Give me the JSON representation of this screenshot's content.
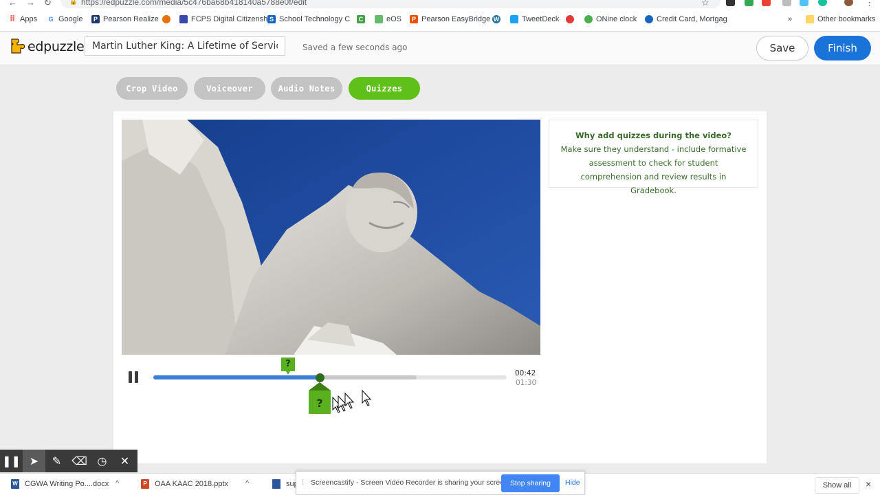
{
  "browser": {
    "url": "https://edpuzzle.com/media/5c476ba68b418140a5788e0f/edit",
    "bookmarks": [
      {
        "label": "Apps",
        "color": "#ea4335"
      },
      {
        "label": "Google",
        "color": "#4285f4"
      },
      {
        "label": "Pearson Realize",
        "color": "#1e3a6e"
      },
      {
        "label": "",
        "color": "#e8710a"
      },
      {
        "label": "FCPS Digital Citizensh",
        "color": "#3949ab"
      },
      {
        "label": "School Technology C",
        "color": "#1565c0"
      },
      {
        "label": "",
        "color": "#43a047"
      },
      {
        "label": "eOS",
        "color": "#66bb6a"
      },
      {
        "label": "Pearson EasyBridge",
        "color": "#e65100"
      },
      {
        "label": "",
        "color": "#21759b"
      },
      {
        "label": "TweetDeck",
        "color": "#1da1f2"
      },
      {
        "label": "",
        "color": "#e53935"
      },
      {
        "label": "ONine clock",
        "color": "#4caf50"
      },
      {
        "label": "Credit Card, Mortgag",
        "color": "#1565c0"
      }
    ],
    "bookmarks_more": "»",
    "other_bookmarks": "Other bookmarks"
  },
  "header": {
    "logo": "edpuzzle",
    "video_title": "Martin Luther King: A Lifetime of Service",
    "saved_status": "Saved a few seconds ago",
    "save_label": "Save",
    "finish_label": "Finish"
  },
  "tabs": [
    {
      "label": "Crop Video",
      "active": false
    },
    {
      "label": "Voiceover",
      "active": false
    },
    {
      "label": "Audio Notes",
      "active": false
    },
    {
      "label": "Quizzes",
      "active": true
    }
  ],
  "info": {
    "title": "Why add quizzes during the video?",
    "body": "Make sure they understand - include formative assessment to check for student comprehension and review results in Gradebook."
  },
  "player": {
    "current_time": "00:42",
    "total_time": "01:30",
    "progress_fraction": 0.47,
    "buffered_fraction": 0.745,
    "quiz_marker_label": "?",
    "add_quiz_label": "?"
  },
  "downloads": [
    {
      "label": "CGWA Writing Po....docx",
      "color": "#2b579a",
      "type": "W"
    },
    {
      "label": "OAA KAAC 2018.pptx",
      "color": "#d24726",
      "type": "P"
    },
    {
      "label": "sup",
      "color": "#2b579a",
      "type": ""
    }
  ],
  "download_bar": {
    "show_all_label": "Show all",
    "close": "×"
  },
  "share_notice": {
    "text": "Screencastify - Screen Video Recorder is sharing your screen.",
    "stop_label": "Stop sharing",
    "hide_label": "Hide"
  },
  "colors": {
    "accent_green": "#5fc019",
    "accent_blue": "#1a73d9",
    "inactive_tab": "#c3c3c3",
    "info_text": "#3b6b2c"
  }
}
